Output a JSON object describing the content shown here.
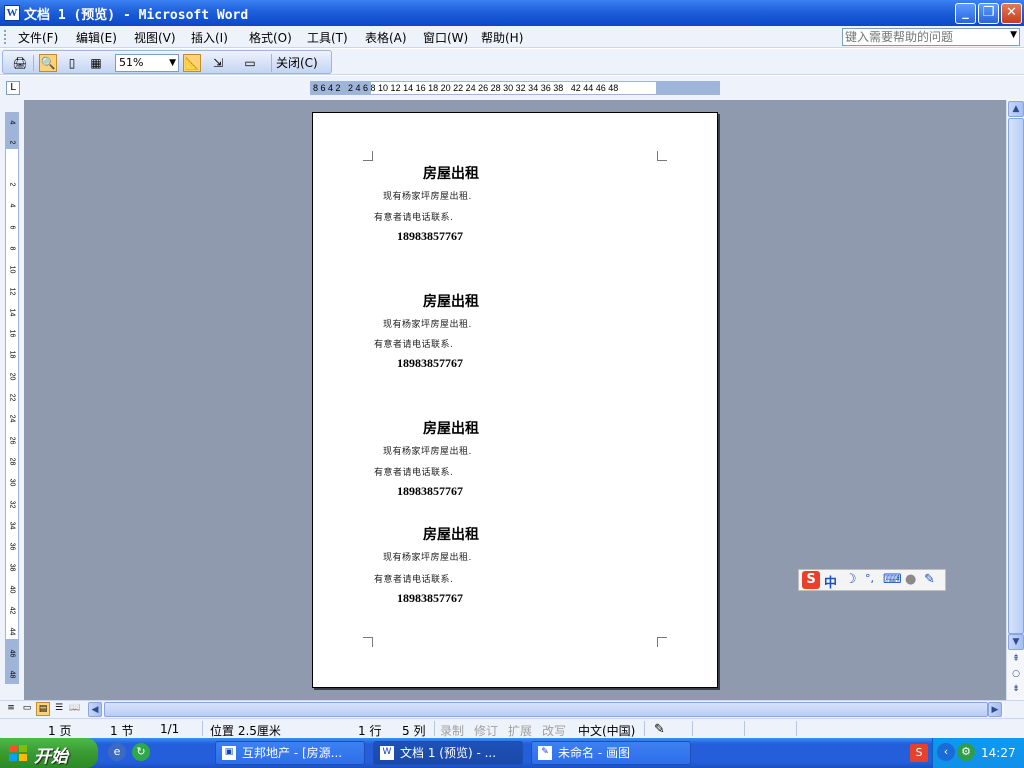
{
  "window": {
    "title": "文档 1 (预览) - Microsoft Word",
    "minimize": "_",
    "restore": "❐",
    "close": "✕"
  },
  "menu": {
    "items": [
      "文件(F)",
      "编辑(E)",
      "视图(V)",
      "插入(I)",
      "格式(O)",
      "工具(T)",
      "表格(A)",
      "窗口(W)",
      "帮助(H)"
    ],
    "help_placeholder": "键入需要帮助的问题"
  },
  "toolbar": {
    "zoom": "51%",
    "close_label": "关闭(C)"
  },
  "ruler": {
    "horizontal": "8 6 4 2   2 4 6 8 10 12 14 16 18 20 22 24 26 28 30 32 34 36 38   42 44 46 48",
    "vertical": [
      "4",
      "2",
      "2",
      "4",
      "6",
      "8",
      "10",
      "12",
      "14",
      "16",
      "18",
      "20",
      "22",
      "24",
      "26",
      "28",
      "30",
      "32",
      "34",
      "36",
      "38",
      "40",
      "42",
      "44",
      "46",
      "48"
    ]
  },
  "document": {
    "blocks": [
      {
        "heading": "房屋出租",
        "line1": "现有杨家坪房屋出租.",
        "line2": "有意者请电话联系.",
        "phone": "18983857767"
      },
      {
        "heading": "房屋出租",
        "line1": "现有杨家坪房屋出租.",
        "line2": "有意者请电话联系.",
        "phone": "18983857767"
      },
      {
        "heading": "房屋出租",
        "line1": "现有杨家坪房屋出租.",
        "line2": "有意者请电话联系.",
        "phone": "18983857767"
      },
      {
        "heading": "房屋出租",
        "line1": "现有杨家坪房屋出租.",
        "line2": "有意者请电话联系.",
        "phone": "18983857767"
      }
    ]
  },
  "ime": {
    "logo": "S",
    "mode": "中",
    "moon": "☽",
    "punct": "°,",
    "keyboard": "⌨",
    "user": "●",
    "tool": "✎"
  },
  "status": {
    "page": "1 页",
    "section": "1 节",
    "page_of": "1/1",
    "position": "位置 2.5厘米",
    "line": "1 行",
    "col": "5 列",
    "rec": "录制",
    "trk": "修订",
    "ext": "扩展",
    "ovr": "改写",
    "lang": "中文(中国)"
  },
  "taskbar": {
    "start": "开始",
    "tasks": [
      "互邦地产 - [房源...",
      "文档 1 (预览) - ...",
      "未命名 - 画图"
    ],
    "clock": "14:27"
  },
  "colors": {
    "titlebar": "#0a48c8",
    "workspace": "#8f9aae",
    "taskbar": "#245edb",
    "start": "#3a9a33"
  }
}
